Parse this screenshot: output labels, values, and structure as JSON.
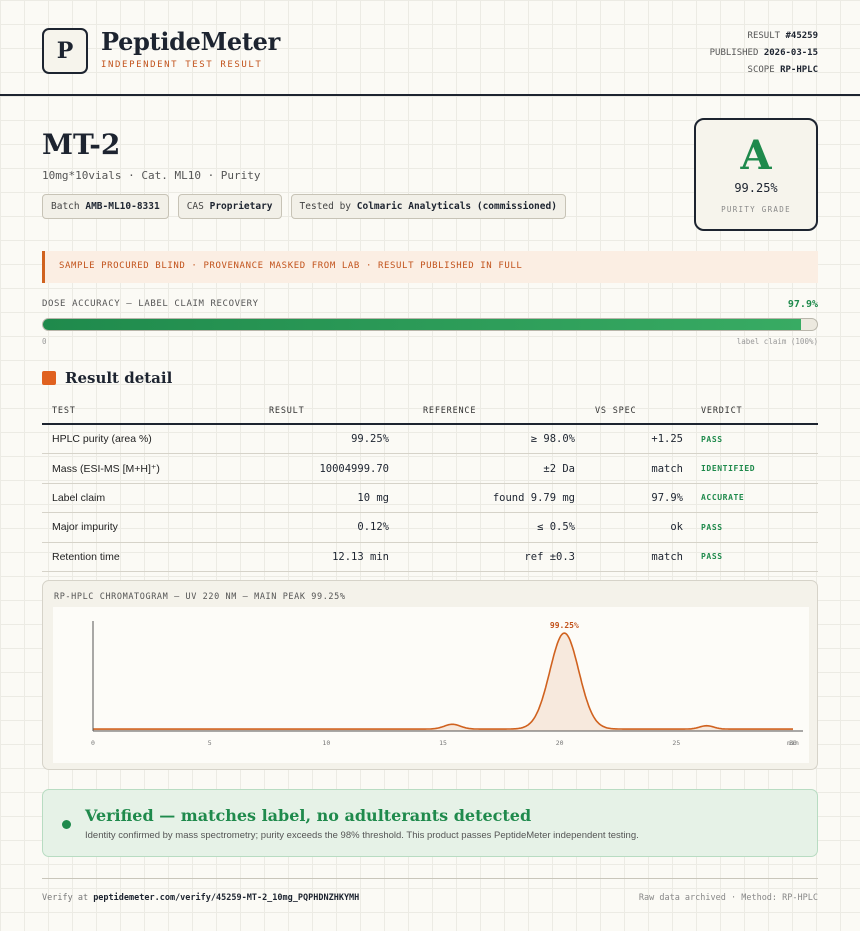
{
  "header": {
    "logo_letter": "P",
    "brand": "PeptideMeter",
    "tagline": "INDEPENDENT TEST RESULT",
    "result_label": "RESULT",
    "result_id": "#45259",
    "published_label": "PUBLISHED",
    "published_date": "2026-03-15",
    "scope_label": "SCOPE",
    "scope_value": "RP-HPLC"
  },
  "product": {
    "name": "MT-2",
    "subtitle": "10mg*10vials · Cat. ML10 · Purity",
    "chips": [
      {
        "label": "Batch",
        "value": "AMB-ML10-8331"
      },
      {
        "label": "CAS",
        "value": "Proprietary"
      },
      {
        "label": "Tested by",
        "value": "Colmaric Analyticals (commissioned)"
      }
    ]
  },
  "grade": {
    "letter": "A",
    "value": "99.25%",
    "label": "PURITY GRADE",
    "color": "#1f8a4c"
  },
  "notice": "SAMPLE PROCURED BLIND · PROVENANCE MASKED FROM LAB · RESULT PUBLISHED IN FULL",
  "dose": {
    "label": "DOSE ACCURACY — LABEL CLAIM RECOVERY",
    "value": "97.9%",
    "fill": 0.979,
    "min_label": "0",
    "max_label": "label claim (100%)"
  },
  "section_title": "Result detail",
  "table": {
    "headers": [
      "TEST",
      "RESULT",
      "REFERENCE",
      "VS SPEC",
      "VERDICT"
    ],
    "rows": [
      {
        "test": "HPLC purity (area %)",
        "result": "99.25%",
        "reference": "≥ 98.0%",
        "vs_spec": "+1.25",
        "verdict": "PASS"
      },
      {
        "test": "Mass (ESI-MS [M+H]⁺)",
        "result": "10004999.70",
        "reference": "±2 Da",
        "vs_spec": "match",
        "verdict": "IDENTIFIED"
      },
      {
        "test": "Label claim",
        "result": "10 mg",
        "reference": "found 9.79 mg",
        "vs_spec": "97.9%",
        "verdict": "ACCURATE"
      },
      {
        "test": "Major impurity",
        "result": "0.12%",
        "reference": "≤ 0.5%",
        "vs_spec": "ok",
        "verdict": "PASS"
      },
      {
        "test": "Retention time",
        "result": "12.13 min",
        "reference": "ref ±0.3",
        "vs_spec": "match",
        "verdict": "PASS"
      }
    ]
  },
  "chromatogram": {
    "title": "RP-HPLC CHROMATOGRAM — UV 220 NM — MAIN PEAK 99.25%",
    "chart_data": {
      "type": "line",
      "title": "RP-HPLC CHROMATOGRAM — UV 220 NM — MAIN PEAK 99.25%",
      "x_ticks": [
        "0",
        "5",
        "10",
        "15",
        "20",
        "25",
        "30",
        "min"
      ],
      "xlim": [
        0,
        30
      ],
      "peaks": [
        {
          "x": 15.4,
          "height": 0.05,
          "width": 0.35
        },
        {
          "x": 20.2,
          "height": 1.0,
          "width": 0.62,
          "label": "99.25%"
        },
        {
          "x": 26.3,
          "height": 0.035,
          "width": 0.3
        }
      ],
      "baseline": 0.02,
      "line_color": "#d0621f"
    }
  },
  "verified": {
    "title": "Verified — matches label, no adulterants detected",
    "text": "Identity confirmed by mass spectrometry; purity exceeds the 98% threshold. This product passes PeptideMeter independent testing."
  },
  "footer": {
    "verify_prefix": "Verify at",
    "verify_url": "peptidemeter.com/verify/45259-MT-2_10mg_PQPHDNZHKYMH",
    "right_text": "Raw data archived · Method: RP-HPLC"
  }
}
